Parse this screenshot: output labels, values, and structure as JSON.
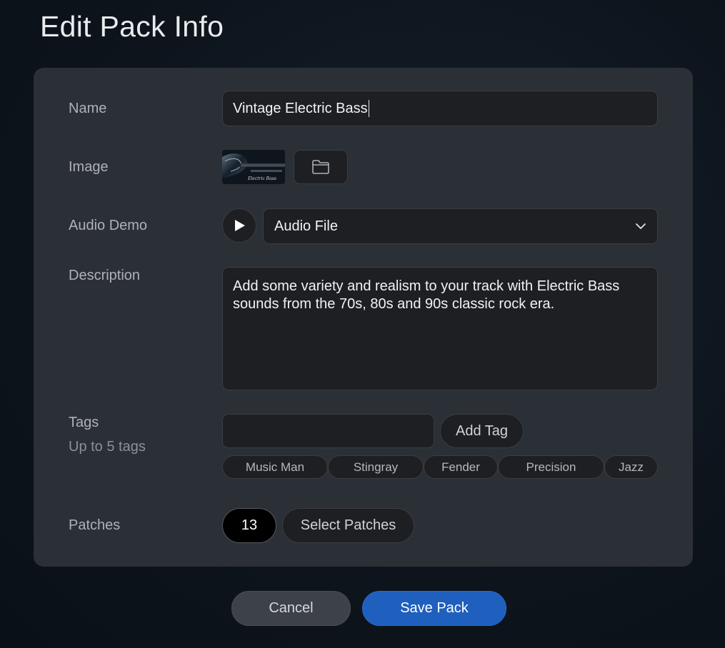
{
  "page": {
    "title": "Edit Pack Info"
  },
  "form": {
    "name_label": "Name",
    "name_value": "Vintage Electric Bass",
    "image_label": "Image",
    "image_caption": "Electric Bass",
    "audio_label": "Audio Demo",
    "audio_selected": "Audio File",
    "description_label": "Description",
    "description_value": "Add some variety and realism to your track with Electric Bass sounds from the 70s, 80s and 90s classic rock era.",
    "tags_label": "Tags",
    "tags_hint": "Up to 5 tags",
    "tag_input_value": "",
    "add_tag_label": "Add Tag",
    "tags": [
      "Music Man",
      "Stingray",
      "Fender",
      "Precision",
      "Jazz"
    ],
    "patches_label": "Patches",
    "patches_count": "13",
    "select_patches_label": "Select Patches"
  },
  "footer": {
    "cancel_label": "Cancel",
    "save_label": "Save Pack"
  },
  "colors": {
    "panel": "#2b2f36",
    "field": "#1e1f23",
    "accent": "#1f5fbd"
  },
  "icons": {
    "folder": "folder-icon",
    "play": "play-icon",
    "dropdown": "chevron-down-icon"
  }
}
